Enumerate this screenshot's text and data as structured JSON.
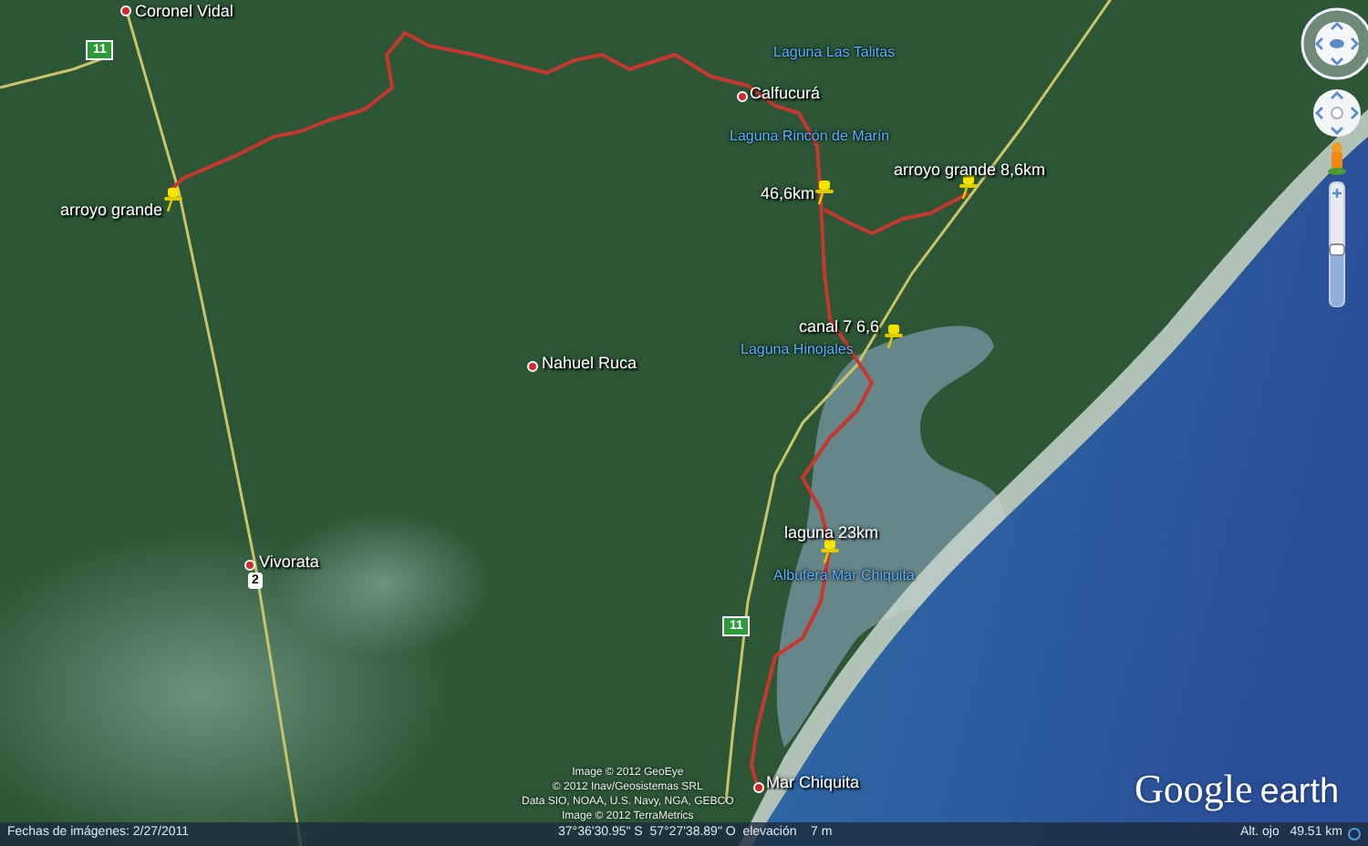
{
  "map": {
    "places": [
      {
        "kind": "town",
        "label": "Coronel Vidal"
      },
      {
        "kind": "placemark",
        "label": "arroyo grande"
      },
      {
        "kind": "lake",
        "label": "Laguna Las Talitas"
      },
      {
        "kind": "town",
        "label": "Calfucurá"
      },
      {
        "kind": "lake",
        "label": "Laguna Rincón de Marín"
      },
      {
        "kind": "placemark",
        "label": "46,6km"
      },
      {
        "kind": "placemark",
        "label": "arroyo grande 8,6km"
      },
      {
        "kind": "placemark",
        "label": "canal 7 6,6"
      },
      {
        "kind": "lake",
        "label": "Laguna Hinojales"
      },
      {
        "kind": "town",
        "label": "Nahuel Ruca"
      },
      {
        "kind": "town",
        "label": "Vivorata"
      },
      {
        "kind": "placemark",
        "label": "laguna 23km"
      },
      {
        "kind": "lake",
        "label": "Albufera Mar Chiquita"
      },
      {
        "kind": "town",
        "label": "Mar Chiquita"
      }
    ],
    "road_shields": [
      {
        "kind": "national",
        "label": "11"
      },
      {
        "kind": "provincial",
        "label": "2"
      },
      {
        "kind": "national",
        "label": "11"
      }
    ]
  },
  "attribution": [
    "Image © 2012 GeoEye",
    "© 2012 Inav/Geosistemas SRL",
    "Data SIO, NOAA, U.S. Navy, NGA, GEBCO",
    "Image © 2012 TerraMetrics"
  ],
  "navigation": {
    "zoom_slider": {
      "level": 0.5
    }
  },
  "logo": {
    "word_1": "Google",
    "word_2": "earth"
  },
  "status_bar": {
    "imagery_date": "Fechas de imágenes: 2/27/2011",
    "pointer": "37°36'30.95\" S  57°27'38.89\" O  elevación    7 m",
    "eye_altitude": "Alt. ojo   49.51 km"
  }
}
